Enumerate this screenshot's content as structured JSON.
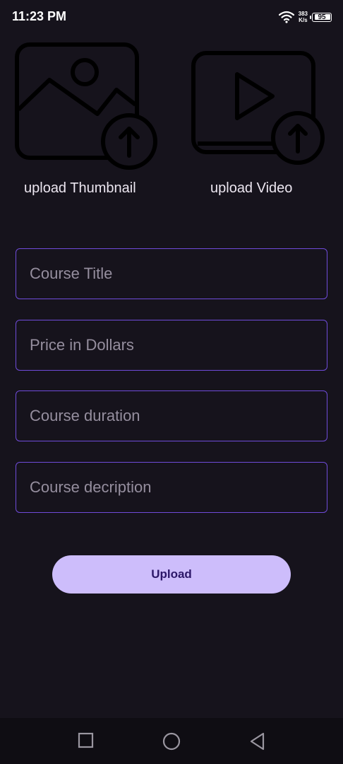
{
  "status_bar": {
    "time": "11:23 PM",
    "net_speed_value": "383",
    "net_speed_unit": "K/s",
    "battery_level": "95",
    "icons": [
      "wifi-icon",
      "battery-icon"
    ]
  },
  "media": {
    "thumbnail_label": "upload Thumbnail",
    "video_label": "upload Video",
    "icons": [
      "image-upload-icon",
      "video-upload-icon"
    ]
  },
  "form": {
    "course_title_placeholder": "Course Title",
    "price_placeholder": "Price in Dollars",
    "duration_placeholder": "Course duration",
    "description_placeholder": "Course decription",
    "course_title_value": "",
    "price_value": "",
    "duration_value": "",
    "description_value": ""
  },
  "actions": {
    "upload_label": "Upload"
  },
  "nav_bar": {
    "icons": [
      "recents-square-icon",
      "home-circle-icon",
      "back-triangle-icon"
    ]
  },
  "colors": {
    "background": "#16131c",
    "field_border": "#6f4bd9",
    "button_background": "#cdbdfb",
    "button_text": "#2c1768"
  }
}
